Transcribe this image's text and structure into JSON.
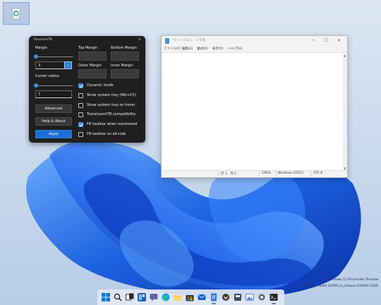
{
  "desktop": {
    "icon_name": "recycle-bin-icon"
  },
  "roundedtb": {
    "title": "RoundedTB",
    "close_glyph": "×",
    "margin_label": "Margin",
    "margin_value": "3",
    "margin_slider_level": 0,
    "corner_radius_label": "Corner radius",
    "corner_radius_value": "7",
    "corner_radius_slider_level": 0,
    "spin_glyph": "⌄",
    "advanced_label": "Advanced",
    "help_about_label": "Help & About",
    "apply_label": "Apply",
    "top_margin_label": "Top Margin",
    "bottom_margin_label": "Bottom Margin",
    "outer_margin_label": "Outer Margin",
    "inner_margin_label": "Inner Margin",
    "checkboxes": [
      {
        "label": "Dynamic mode",
        "checked": true
      },
      {
        "label": "Show system tray (Win+F2)",
        "checked": false
      },
      {
        "label": "Show system tray on hover",
        "checked": false
      },
      {
        "label": "TranslucentTB compatibility",
        "checked": false
      },
      {
        "label": "Fill taskbar when maximised",
        "checked": true
      },
      {
        "label": "Fill taskbar on alt+tab",
        "checked": false
      }
    ],
    "accent_color": "#3f8ee6"
  },
  "notepad": {
    "title": "*タイトルなし - メモ帳",
    "menus": [
      "ファイル(F)",
      "編集(E)",
      "書式(O)",
      "表示(V)",
      "ヘルプ(H)"
    ],
    "status": {
      "position": "行 1、列 1",
      "zoom": "100%",
      "line_ending": "Windows (CRLF)",
      "encoding": "UTF-8"
    },
    "minimize_glyph": "─",
    "maximize_glyph": "☐",
    "close_glyph": "✕",
    "scroll_up_glyph": "▲",
    "scroll_down_glyph": "▼"
  },
  "watermark": {
    "line1": "Windows 11 Pro Insider Preview",
    "line2": "評価コピー。Build 22000.co_release.210604-1628"
  },
  "taskbar": {
    "icons": [
      "start-icon",
      "search-icon",
      "task-view-icon",
      "widgets-icon",
      "chat-icon",
      "edge-icon",
      "file-explorer-icon",
      "store-icon",
      "mail-icon",
      "notepad-icon",
      "app-icon",
      "app-icon",
      "photos-icon",
      "settings-icon",
      "terminal-icon",
      "app-icon"
    ]
  }
}
